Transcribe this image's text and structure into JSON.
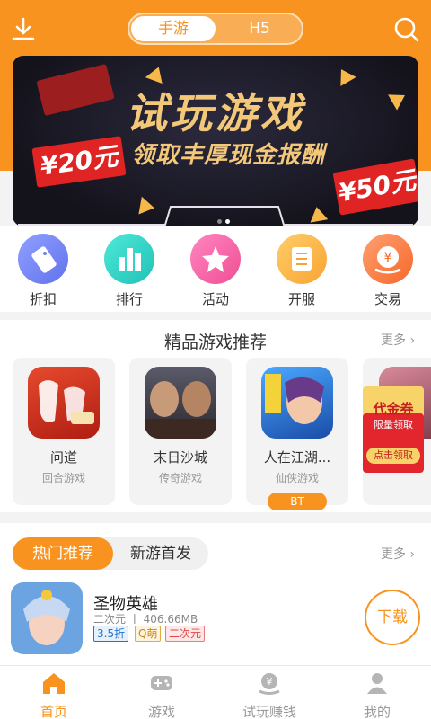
{
  "top_bar": {
    "segments": [
      "手游",
      "H5"
    ],
    "download_icon": "download-icon",
    "search_icon": "search-icon"
  },
  "banner": {
    "title": "试玩游戏",
    "subtitle": "领取丰厚现金报酬",
    "coupon_left": "¥20元",
    "coupon_right": "¥50元"
  },
  "quick_links": [
    {
      "label": "折扣",
      "icon": "sale-tag-icon",
      "color": "#7c8cf5"
    },
    {
      "label": "排行",
      "icon": "ranking-bars-icon",
      "color": "#2fd1c4"
    },
    {
      "label": "活动",
      "icon": "star-icon",
      "color": "#f565a8"
    },
    {
      "label": "开服",
      "icon": "server-icon",
      "color": "#fbb44a"
    },
    {
      "label": "交易",
      "icon": "yuan-coin-icon",
      "color": "#fa7a3e"
    }
  ],
  "recommend": {
    "title": "精品游戏推荐",
    "more": "更多",
    "games": [
      {
        "name": "问道",
        "category": "回合游戏",
        "badge": ""
      },
      {
        "name": "末日沙城",
        "category": "传奇游戏",
        "badge": ""
      },
      {
        "name": "人在江湖...",
        "category": "仙侠游戏",
        "badge": "BT"
      },
      {
        "name": "",
        "category": "",
        "badge": ""
      }
    ]
  },
  "float_coupon": {
    "title": "代金券",
    "sub": "限量领取",
    "button": "点击领取"
  },
  "hot": {
    "tabs": [
      "热门推荐",
      "新游首发"
    ],
    "more": "更多",
    "game": {
      "name": "圣物英雄",
      "meta": "二次元 丨 406.66MB",
      "tags": [
        "3.5折",
        "Q萌",
        "二次元"
      ],
      "download": "下载"
    }
  },
  "bottom_nav": [
    {
      "label": "首页",
      "icon": "home-icon",
      "active": true
    },
    {
      "label": "游戏",
      "icon": "gamepad-icon",
      "active": false
    },
    {
      "label": "试玩赚钱",
      "icon": "earn-money-icon",
      "active": false
    },
    {
      "label": "我的",
      "icon": "user-icon",
      "active": false
    }
  ],
  "colors": {
    "accent": "#f7931e",
    "background": "#f3f3f3"
  }
}
